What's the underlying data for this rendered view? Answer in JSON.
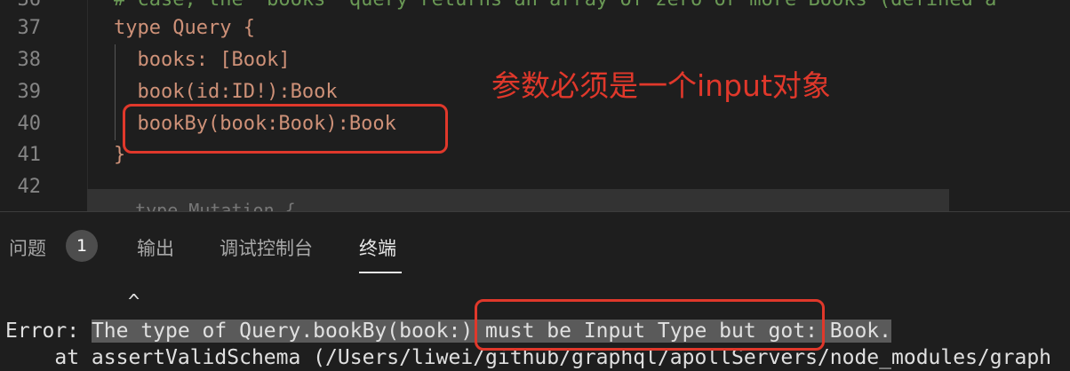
{
  "editor": {
    "lines": [
      {
        "num": "36",
        "text": "# case, the \"books\" query returns an array of zero or more Books (defined a"
      },
      {
        "num": "37",
        "text": "type Query {"
      },
      {
        "num": "38",
        "text": "  books: [Book]"
      },
      {
        "num": "39",
        "text": "  book(id:ID!):Book"
      },
      {
        "num": "40",
        "text": "  bookBy(book:Book):Book"
      },
      {
        "num": "41",
        "text": "}"
      },
      {
        "num": "42",
        "text": ""
      }
    ],
    "next_line_partial": "  type Mutation {"
  },
  "annotation": {
    "text": "参数必须是一个input对象"
  },
  "panel": {
    "tabs": [
      {
        "label": "问题",
        "badge": "1"
      },
      {
        "label": "输出"
      },
      {
        "label": "调试控制台"
      },
      {
        "label": "终端"
      }
    ],
    "active_tab": "终端"
  },
  "terminal": {
    "caret": "^",
    "error_prefix": "Error: ",
    "error_message": "The type of Query.bookBy(book:) must be Input Type but got: Book.",
    "stack_line": "    at assertValidSchema (/Users/liwei/github/graphql/apollServers/node_modules/graph"
  },
  "colors": {
    "annotation_red": "#e0382b",
    "code_string": "#ce9178",
    "editor_bg": "#1e1e1e"
  }
}
